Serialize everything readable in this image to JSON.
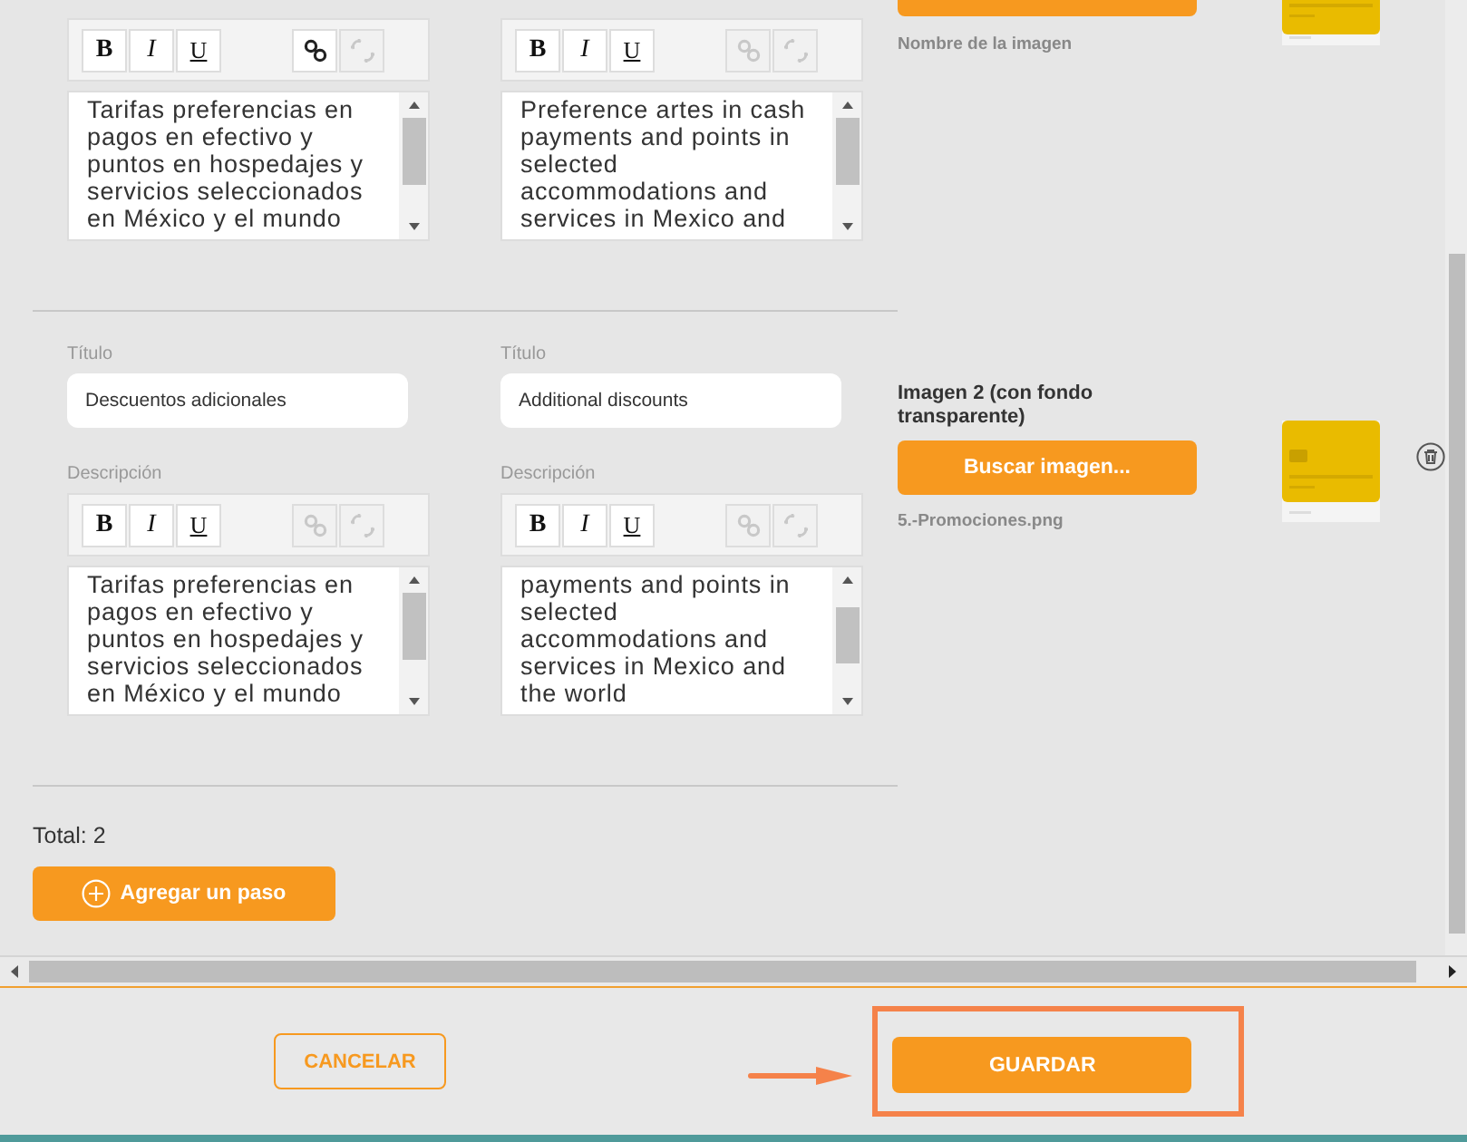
{
  "steps": [
    {
      "columns": [
        {
          "toolbar": [
            {
              "kind": "bold",
              "label": "B",
              "disabled": false
            },
            {
              "kind": "italic",
              "label": "I",
              "disabled": false
            },
            {
              "kind": "underline",
              "label": "U",
              "disabled": false
            },
            {
              "kind": "link",
              "disabled": false
            },
            {
              "kind": "unlink",
              "disabled": true
            }
          ],
          "description": "Tarifas preferencias en pagos en efectivo y puntos en hospedajes y servicios seleccionados en México y el mundo"
        },
        {
          "toolbar": [
            {
              "kind": "bold",
              "label": "B",
              "disabled": false
            },
            {
              "kind": "italic",
              "label": "I",
              "disabled": false
            },
            {
              "kind": "underline",
              "label": "U",
              "disabled": false
            },
            {
              "kind": "link",
              "disabled": true
            },
            {
              "kind": "unlink",
              "disabled": true
            }
          ],
          "description": "Preference artes in cash payments and points in selected accommodations and services in Mexico and"
        }
      ],
      "image": {
        "has_button": true,
        "file_name": "Nombre de la imagen",
        "deletable": false
      }
    },
    {
      "columns": [
        {
          "title_label": "Título",
          "title": "Descuentos adicionales",
          "description_label": "Descripción",
          "toolbar": [
            {
              "kind": "bold",
              "label": "B",
              "disabled": false
            },
            {
              "kind": "italic",
              "label": "I",
              "disabled": false
            },
            {
              "kind": "underline",
              "label": "U",
              "disabled": false
            },
            {
              "kind": "link",
              "disabled": true
            },
            {
              "kind": "unlink",
              "disabled": true
            }
          ],
          "description": "Tarifas preferencias en pagos en efectivo y puntos en hospedajes y servicios seleccionados en México y el mundo"
        },
        {
          "title_label": "Título",
          "title": "Additional discounts",
          "description_label": "Descripción",
          "toolbar": [
            {
              "kind": "bold",
              "label": "B",
              "disabled": false
            },
            {
              "kind": "italic",
              "label": "I",
              "disabled": false
            },
            {
              "kind": "underline",
              "label": "U",
              "disabled": false
            },
            {
              "kind": "link",
              "disabled": true
            },
            {
              "kind": "unlink",
              "disabled": true
            }
          ],
          "description": "payments and points in selected accommodations and services in Mexico and the world"
        }
      ],
      "image": {
        "label": "Imagen 2 (con fondo transparente)",
        "has_button": true,
        "button": "Buscar imagen...",
        "file_name": "5.-Promociones.png",
        "deletable": true
      }
    }
  ],
  "total": "Total: 2",
  "add_step_button": "Agregar un paso",
  "footer": {
    "cancel_button": "CANCELAR",
    "save_button": "GUARDAR",
    "save_highlighted": true
  }
}
